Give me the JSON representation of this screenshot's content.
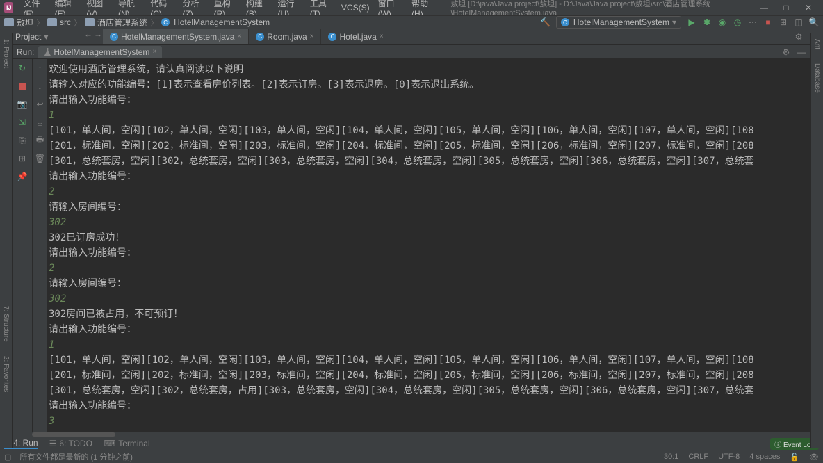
{
  "app": {
    "logo": "IJ"
  },
  "menu": {
    "file": "文件(F)",
    "edit": "编辑(E)",
    "view": "视图(V)",
    "nav": "导航(N)",
    "code": "代码(C)",
    "analyze": "分析(Z)",
    "refactor": "重构(R)",
    "build": "构建(B)",
    "run": "运行(U)",
    "tools": "工具(T)",
    "vcs": "VCS(S)",
    "window": "窗口(W)",
    "help": "帮助(H)"
  },
  "title_path": "敖坦 [D:\\java\\Java project\\敖坦] - D:\\Java\\Java project\\敖坦\\src\\酒店管理系统\\HotelManagementSystem.java",
  "breadcrumb": [
    "敖坦",
    "src",
    "酒店管理系统",
    "HotelManagementSystem"
  ],
  "run_config": "HotelManagementSystem",
  "project_tool": "Project",
  "tabs": [
    {
      "label": "HotelManagementSystem.java",
      "active": true
    },
    {
      "label": "Room.java",
      "active": false
    },
    {
      "label": "Hotel.java",
      "active": false
    }
  ],
  "run_panel": {
    "label": "Run:",
    "tab": "HotelManagementSystem"
  },
  "right_tools": {
    "ant": "Ant",
    "database": "Database"
  },
  "left_tools": {
    "project": "1: Project",
    "structure": "7: Structure",
    "favorites": "2: Favorites"
  },
  "console_lines": [
    {
      "t": "欢迎使用酒店管理系统，请认真阅读以下说明",
      "cls": "c-white"
    },
    {
      "t": "请输入对应的功能编号：[1]表示查看房价列表。[2]表示订房。[3]表示退房。[0]表示退出系统。",
      "cls": "c-white"
    },
    {
      "t": "请出输入功能编号：",
      "cls": "c-white"
    },
    {
      "t": "1",
      "cls": "c-green"
    },
    {
      "t": "[101，单人间，空闲][102，单人间，空闲][103，单人间，空闲][104，单人间，空闲][105，单人间，空闲][106，单人间，空闲][107，单人间，空闲][108",
      "cls": "c-white"
    },
    {
      "t": "[201，标准间，空闲][202，标准间，空闲][203，标准间，空闲][204，标准间，空闲][205，标准间，空闲][206，标准间，空闲][207，标准间，空闲][208",
      "cls": "c-white"
    },
    {
      "t": "[301，总统套房，空闲][302，总统套房，空闲][303，总统套房，空闲][304，总统套房，空闲][305，总统套房，空闲][306，总统套房，空闲][307，总统套",
      "cls": "c-white"
    },
    {
      "t": "请出输入功能编号：",
      "cls": "c-white"
    },
    {
      "t": "2",
      "cls": "c-green"
    },
    {
      "t": "请输入房间编号：",
      "cls": "c-white"
    },
    {
      "t": "302",
      "cls": "c-green"
    },
    {
      "t": "302已订房成功！",
      "cls": "c-white"
    },
    {
      "t": "请出输入功能编号：",
      "cls": "c-white"
    },
    {
      "t": "2",
      "cls": "c-green"
    },
    {
      "t": "请输入房间编号：",
      "cls": "c-white"
    },
    {
      "t": "302",
      "cls": "c-green"
    },
    {
      "t": "302房间已被占用，不可预订！",
      "cls": "c-white"
    },
    {
      "t": "请出输入功能编号：",
      "cls": "c-white"
    },
    {
      "t": "1",
      "cls": "c-green"
    },
    {
      "t": "[101，单人间，空闲][102，单人间，空闲][103，单人间，空闲][104，单人间，空闲][105，单人间，空闲][106，单人间，空闲][107，单人间，空闲][108",
      "cls": "c-white"
    },
    {
      "t": "[201，标准间，空闲][202，标准间，空闲][203，标准间，空闲][204，标准间，空闲][205，标准间，空闲][206，标准间，空闲][207，标准间，空闲][208",
      "cls": "c-white"
    },
    {
      "t": "[301，总统套房，空闲][302，总统套房，占用][303，总统套房，空闲][304，总统套房，空闲][305，总统套房，空闲][306，总统套房，空闲][307，总统套",
      "cls": "c-white"
    },
    {
      "t": "请出输入功能编号：",
      "cls": "c-white"
    },
    {
      "t": "3",
      "cls": "c-green"
    }
  ],
  "bottom_tabs": {
    "run": "4: Run",
    "todo": "6: TODO",
    "terminal": "Terminal"
  },
  "eventlog": "Event Log",
  "status": {
    "msg": "所有文件都是最新的 (1 分钟之前)",
    "pos": "30:1",
    "le": "CRLF",
    "enc": "UTF-8",
    "indent": "4 spaces"
  }
}
